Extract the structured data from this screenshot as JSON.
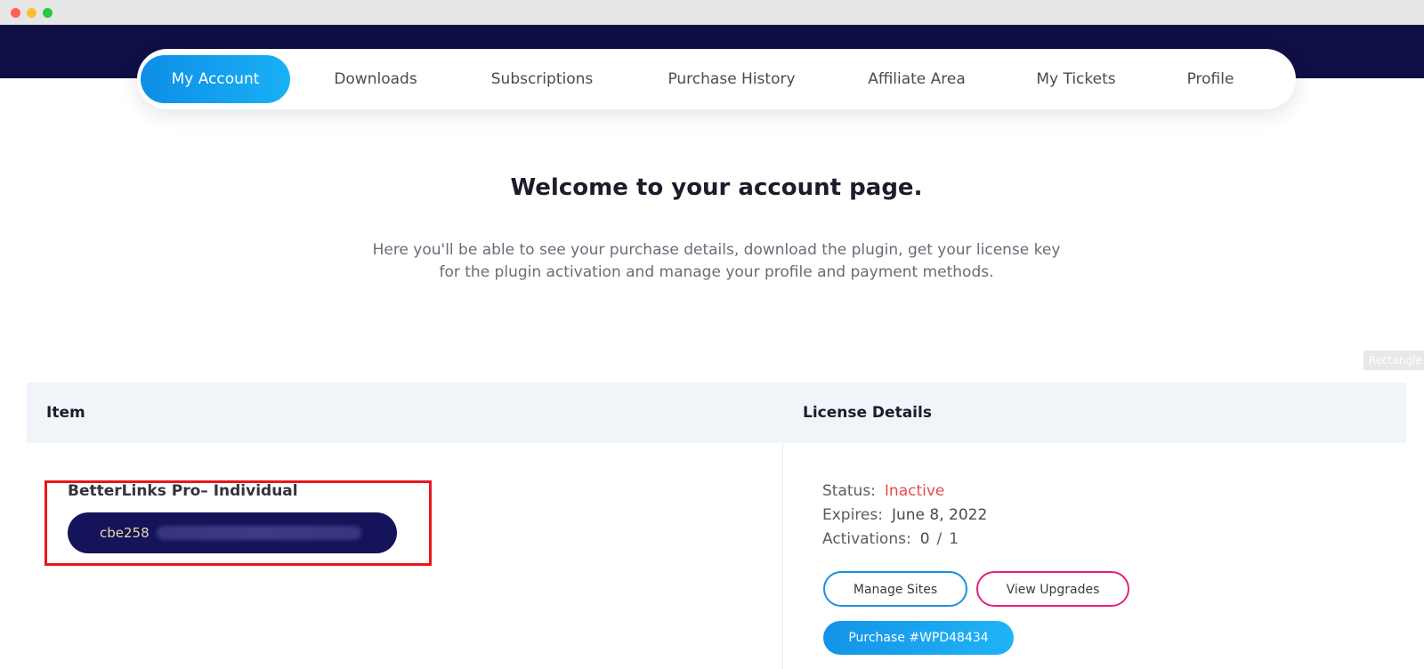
{
  "nav": {
    "tabs": [
      {
        "label": "My Account",
        "active": true
      },
      {
        "label": "Downloads",
        "active": false
      },
      {
        "label": "Subscriptions",
        "active": false
      },
      {
        "label": "Purchase History",
        "active": false
      },
      {
        "label": "Affiliate Area",
        "active": false
      },
      {
        "label": "My Tickets",
        "active": false
      },
      {
        "label": "Profile",
        "active": false
      }
    ]
  },
  "welcome": {
    "title": "Welcome to your account page.",
    "line1": "Here you'll be able to see your purchase details, download the plugin, get your license key",
    "line2": "for the plugin activation and manage your profile and payment methods."
  },
  "overlay_tag": "Rectangle",
  "table": {
    "headers": {
      "item": "Item",
      "license": "License Details"
    },
    "row": {
      "item_name": "BetterLinks Pro– Individual",
      "license_key_prefix": "cbe258",
      "status_label": "Status:",
      "status_value": "Inactive",
      "expires_label": "Expires:",
      "expires_value": "June 8, 2022",
      "activations_label": "Activations:",
      "activations_used": "0",
      "activations_separator": "/",
      "activations_limit": "1",
      "manage_sites_label": "Manage Sites",
      "view_upgrades_label": "View Upgrades",
      "purchase_label": "Purchase #WPD48434"
    }
  },
  "colors": {
    "header_band": "#0f0f45",
    "accent_blue": "#1a8fe3",
    "accent_pink": "#e8207a",
    "status_inactive": "#e84a4a",
    "highlight_red": "#e8161b",
    "license_key_bg": "#15135a"
  }
}
